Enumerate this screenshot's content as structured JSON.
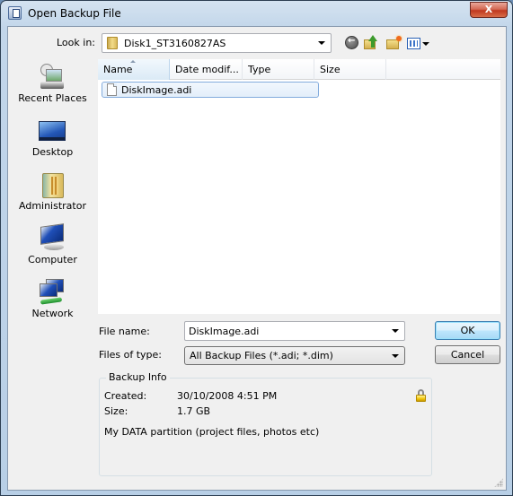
{
  "window": {
    "title": "Open Backup File",
    "close_label": "X"
  },
  "toolbar": {
    "lookin_label": "Look in:",
    "lookin_value": "Disk1_ST3160827AS",
    "icons": [
      "back-icon",
      "up-folder-icon",
      "new-folder-icon",
      "views-menu-icon"
    ]
  },
  "places": [
    {
      "label": "Recent Places",
      "icon": "recent-places-icon"
    },
    {
      "label": "Desktop",
      "icon": "desktop-icon"
    },
    {
      "label": "Administrator",
      "icon": "user-folder-icon"
    },
    {
      "label": "Computer",
      "icon": "computer-icon"
    },
    {
      "label": "Network",
      "icon": "network-icon"
    }
  ],
  "filelist": {
    "columns": [
      "Name",
      "Date modif...",
      "Type",
      "Size"
    ],
    "sorted_column": "Name",
    "files": [
      {
        "name": "DiskImage.adi",
        "selected": true
      }
    ]
  },
  "form": {
    "filename_label": "File name:",
    "filename_value": "DiskImage.adi",
    "filetype_label": "Files of type:",
    "filetype_value": "All Backup Files (*.adi; *.dim)",
    "ok_label": "OK",
    "cancel_label": "Cancel"
  },
  "backup_info": {
    "title": "Backup Info",
    "created_label": "Created:",
    "created_value": "30/10/2008 4:51 PM",
    "size_label": "Size:",
    "size_value": "1.7 GB",
    "description": "My DATA partition (project files, photos etc)",
    "locked": true
  }
}
